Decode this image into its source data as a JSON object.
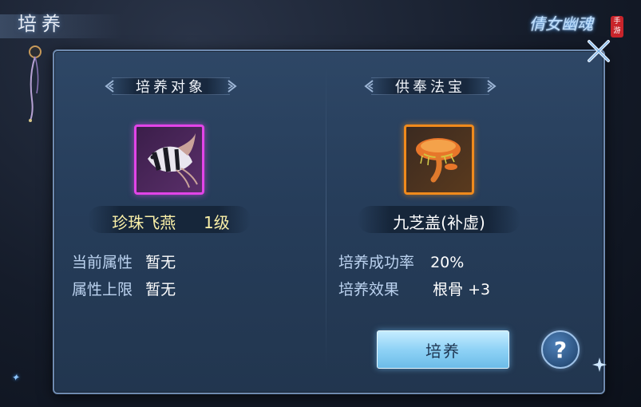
{
  "page": {
    "title": "培养"
  },
  "logo": {
    "text": "倩女幽魂",
    "badge": "手游"
  },
  "left_section": {
    "header": "培养对象",
    "item_name": "珍珠飞燕",
    "item_level": "1级",
    "item_icon": "angelfish-icon",
    "attributes": [
      {
        "label": "当前属性",
        "value": "暂无"
      },
      {
        "label": "属性上限",
        "value": "暂无"
      }
    ]
  },
  "right_section": {
    "header": "供奉法宝",
    "item_name": "九芝盖(补虚)",
    "item_icon": "lingzhi-mushroom-icon",
    "attributes": [
      {
        "label": "培养成功率",
        "value": "20%"
      },
      {
        "label": "培养效果",
        "value": "根骨 +3"
      }
    ]
  },
  "actions": {
    "culture_label": "培养",
    "help_label": "?"
  },
  "colors": {
    "rarity_purple": "#e244e8",
    "rarity_orange": "#f08a1c",
    "item_name_yellow": "#fbf1a8",
    "label_blue": "#bcd3f0",
    "button_blue": "#8fd2f6"
  }
}
